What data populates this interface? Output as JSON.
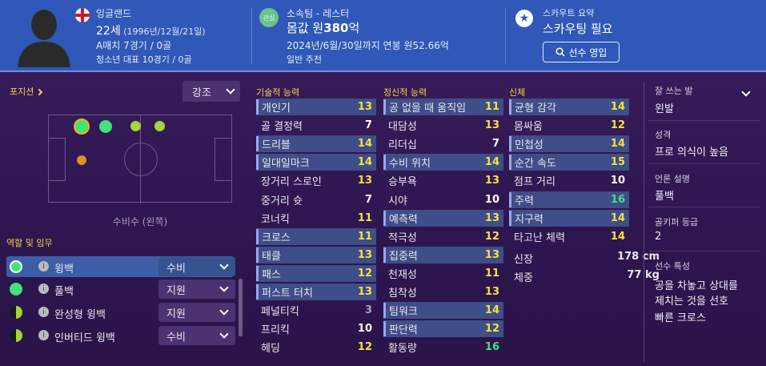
{
  "header": {
    "nationality": "잉글랜드",
    "age_label": "22세",
    "birth": "(1996년/12월/21일)",
    "caps": "A매치 7경기 / 0골",
    "youth_caps": "청소년 대표 10경기 / 0골",
    "interest_badge": "관심",
    "club": "소속팀 - 레스터",
    "value_prefix": "몸값 원",
    "value": "380",
    "value_suffix": "억",
    "contract": "2024년/6월/30일까지 연봉 원52.66억",
    "squad_status": "일반 주전",
    "scout_title": "스카우트 요약",
    "scout_status": "스카우팅 필요",
    "scout_button": "선수 영입"
  },
  "left": {
    "positions_title": "포지션",
    "emphasis_label": "강조",
    "position_name": "수비수 (왼쪽)",
    "roles_title": "역할 및 임무",
    "roles": [
      {
        "name": "윙백",
        "duty": "수비"
      },
      {
        "name": "풀백",
        "duty": "지원"
      },
      {
        "name": "완성형 윙백",
        "duty": "지원"
      },
      {
        "name": "인버티드 윙백",
        "duty": "수비"
      }
    ]
  },
  "technical": {
    "title": "기술적 능력",
    "items": [
      {
        "name": "개인기",
        "value": "13"
      },
      {
        "name": "골 결정력",
        "value": "7"
      },
      {
        "name": "드리블",
        "value": "14"
      },
      {
        "name": "일대일마크",
        "value": "14"
      },
      {
        "name": "장거리 스로인",
        "value": "13"
      },
      {
        "name": "중거리 슛",
        "value": "7"
      },
      {
        "name": "코너킥",
        "value": "11"
      },
      {
        "name": "크로스",
        "value": "11"
      },
      {
        "name": "태클",
        "value": "13"
      },
      {
        "name": "패스",
        "value": "12"
      },
      {
        "name": "퍼스트 터치",
        "value": "13"
      },
      {
        "name": "페널티킥",
        "value": "3"
      },
      {
        "name": "프리킥",
        "value": "10"
      },
      {
        "name": "헤딩",
        "value": "12"
      }
    ]
  },
  "mental": {
    "title": "정신적 능력",
    "items": [
      {
        "name": "공 없을 때 움직임",
        "value": "11"
      },
      {
        "name": "대담성",
        "value": "13"
      },
      {
        "name": "리더십",
        "value": "7"
      },
      {
        "name": "수비 위치",
        "value": "14"
      },
      {
        "name": "승부욕",
        "value": "13"
      },
      {
        "name": "시야",
        "value": "10"
      },
      {
        "name": "예측력",
        "value": "13"
      },
      {
        "name": "적극성",
        "value": "12"
      },
      {
        "name": "집중력",
        "value": "13"
      },
      {
        "name": "천재성",
        "value": "11"
      },
      {
        "name": "침착성",
        "value": "13"
      },
      {
        "name": "팀워크",
        "value": "14"
      },
      {
        "name": "판단력",
        "value": "12"
      },
      {
        "name": "활동량",
        "value": "16"
      }
    ]
  },
  "physical": {
    "title": "신체",
    "items": [
      {
        "name": "균형 감각",
        "value": "14"
      },
      {
        "name": "몸싸움",
        "value": "12"
      },
      {
        "name": "민첩성",
        "value": "14"
      },
      {
        "name": "순간 속도",
        "value": "15"
      },
      {
        "name": "점프 거리",
        "value": "10"
      },
      {
        "name": "주력",
        "value": "16"
      },
      {
        "name": "지구력",
        "value": "14"
      },
      {
        "name": "타고난 체력",
        "value": "14"
      }
    ],
    "height_label": "신장",
    "height_value": "178 cm",
    "weight_label": "체중",
    "weight_value": "77 kg"
  },
  "side": {
    "foot_title": "잘 쓰는 발",
    "foot_value": "왼발",
    "personality_title": "성격",
    "personality_value": "프로 의식이 높음",
    "media_title": "언론 설명",
    "media_value": "풀백",
    "gk_title": "골키퍼 등급",
    "gk_value": "2",
    "traits_title": "선수 특성",
    "trait1": "공을 차놓고 상대를",
    "trait2": "제치는 것을 선호",
    "trait3": "빠른 크로스"
  },
  "colors": {
    "header_bg": "#2f58b8",
    "accent_yellow": "#f4d54a",
    "value_green": "#40e08a",
    "value_yellow": "#f6e23e"
  }
}
